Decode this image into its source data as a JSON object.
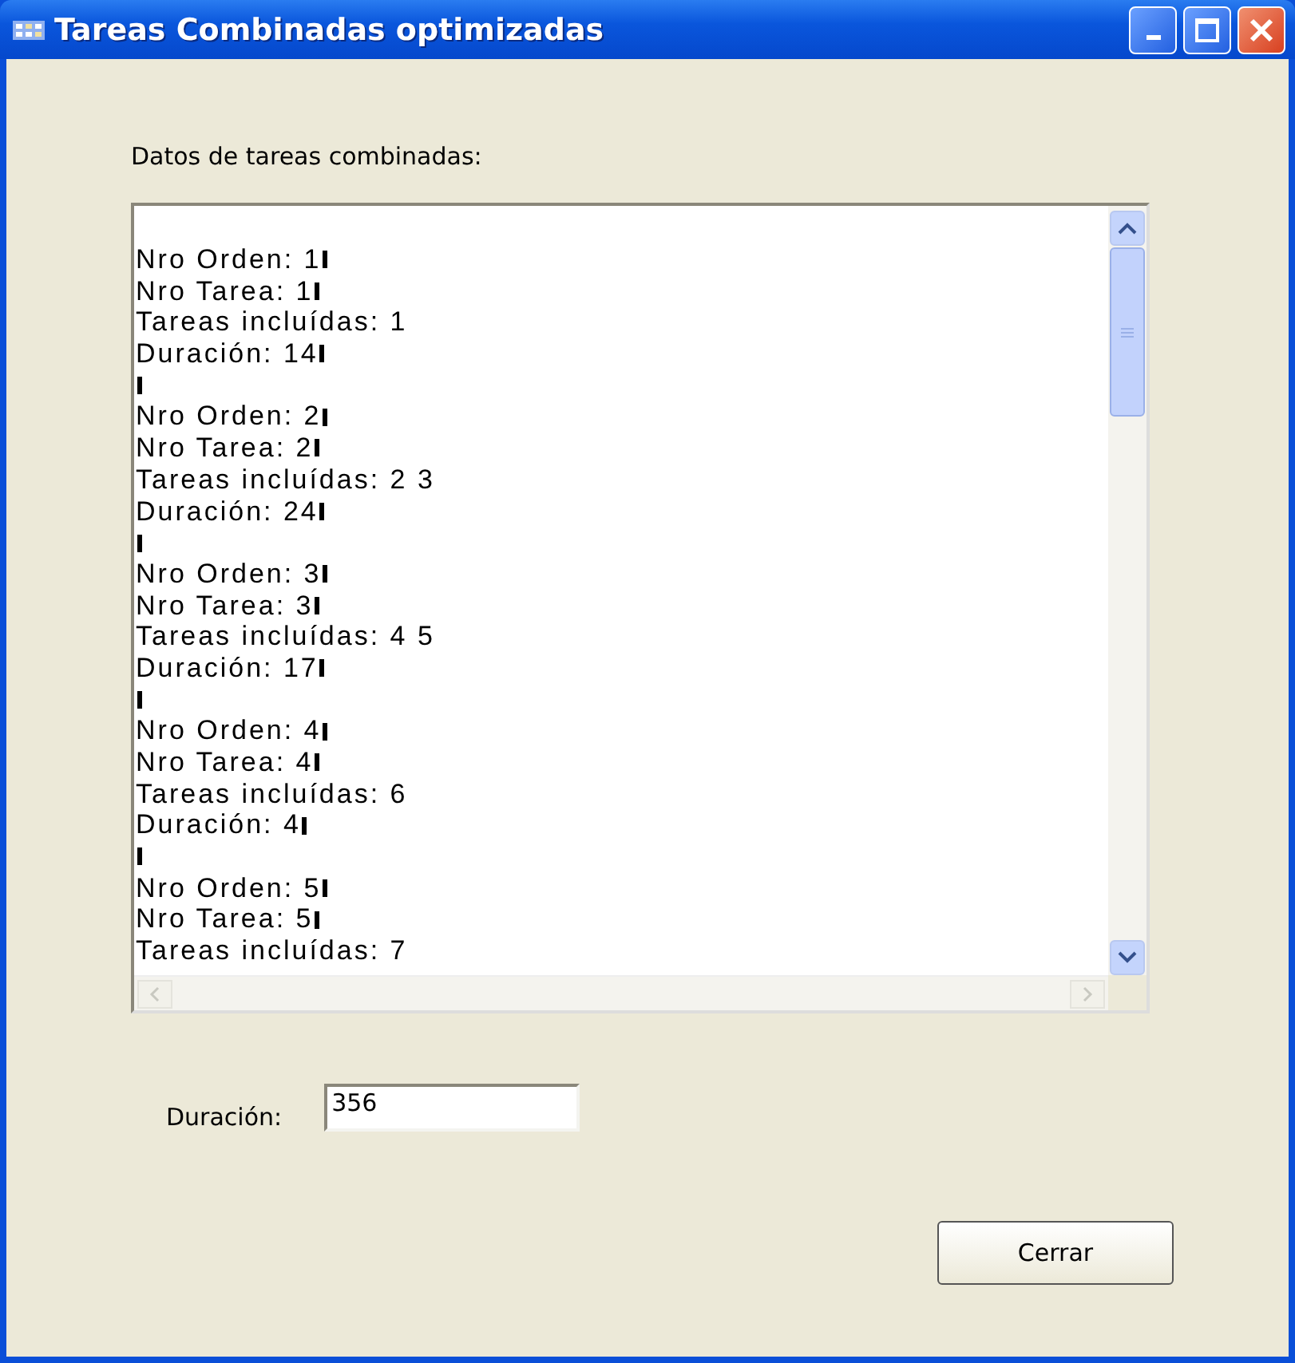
{
  "window": {
    "title": "Tareas Combinadas optimizadas"
  },
  "data_label": "Datos de tareas combinadas:",
  "lines": [
    {
      "text": "Nro Orden: 1",
      "cr": true
    },
    {
      "text": "Nro Tarea: 1",
      "cr": true
    },
    {
      "text": "Tareas incluídas: 1",
      "cr": false
    },
    {
      "text": "Duración: 14",
      "cr": true
    },
    {
      "cr": true
    },
    {
      "text": "Nro Orden: 2",
      "cr": true
    },
    {
      "text": "Nro Tarea: 2",
      "cr": true
    },
    {
      "text": "Tareas incluídas: 2 3",
      "cr": false
    },
    {
      "text": "Duración: 24",
      "cr": true
    },
    {
      "cr": true
    },
    {
      "text": "Nro Orden: 3",
      "cr": true
    },
    {
      "text": "Nro Tarea: 3",
      "cr": true
    },
    {
      "text": "Tareas incluídas: 4 5",
      "cr": false
    },
    {
      "text": "Duración: 17",
      "cr": true
    },
    {
      "cr": true
    },
    {
      "text": "Nro Orden: 4",
      "cr": true
    },
    {
      "text": "Nro Tarea: 4",
      "cr": true
    },
    {
      "text": "Tareas incluídas: 6",
      "cr": false
    },
    {
      "text": "Duración: 4",
      "cr": true
    },
    {
      "cr": true
    },
    {
      "text": "Nro Orden: 5",
      "cr": true
    },
    {
      "text": "Nro Tarea: 5",
      "cr": true
    },
    {
      "text": "Tareas incluídas: 7",
      "cr": false
    }
  ],
  "duration": {
    "label": "Duración:",
    "value": "356"
  },
  "buttons": [
    "Cerrar"
  ]
}
